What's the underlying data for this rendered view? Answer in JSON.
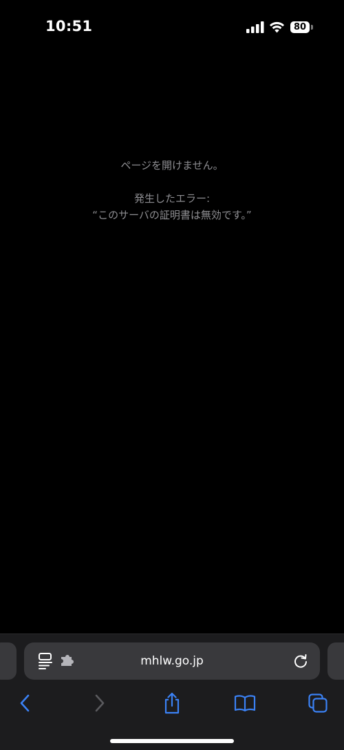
{
  "status_bar": {
    "time": "10:51",
    "battery_level": "80",
    "signal_icon": "cellular-signal-icon",
    "wifi_icon": "wifi-icon"
  },
  "error": {
    "title": "ページを開けません。",
    "label": "発生したエラー:",
    "message": "“このサーバの証明書は無効です。”"
  },
  "address_bar": {
    "url": "mhlw.go.jp",
    "left_icon": "page-settings-icon",
    "extension_icon": "extension-icon",
    "reload_icon": "reload-icon"
  },
  "toolbar": {
    "back_icon": "back-chevron-icon",
    "forward_icon": "forward-chevron-icon",
    "share_icon": "share-icon",
    "bookmarks_icon": "bookmarks-icon",
    "tabs_icon": "tabs-icon",
    "accent_color": "#3b82f6",
    "disabled_color": "#5a5a5e"
  },
  "colors": {
    "background": "#000000",
    "error_text": "#8e8e92",
    "toolbar_bg": "#1c1c1e",
    "address_bar_bg": "#39393c"
  }
}
